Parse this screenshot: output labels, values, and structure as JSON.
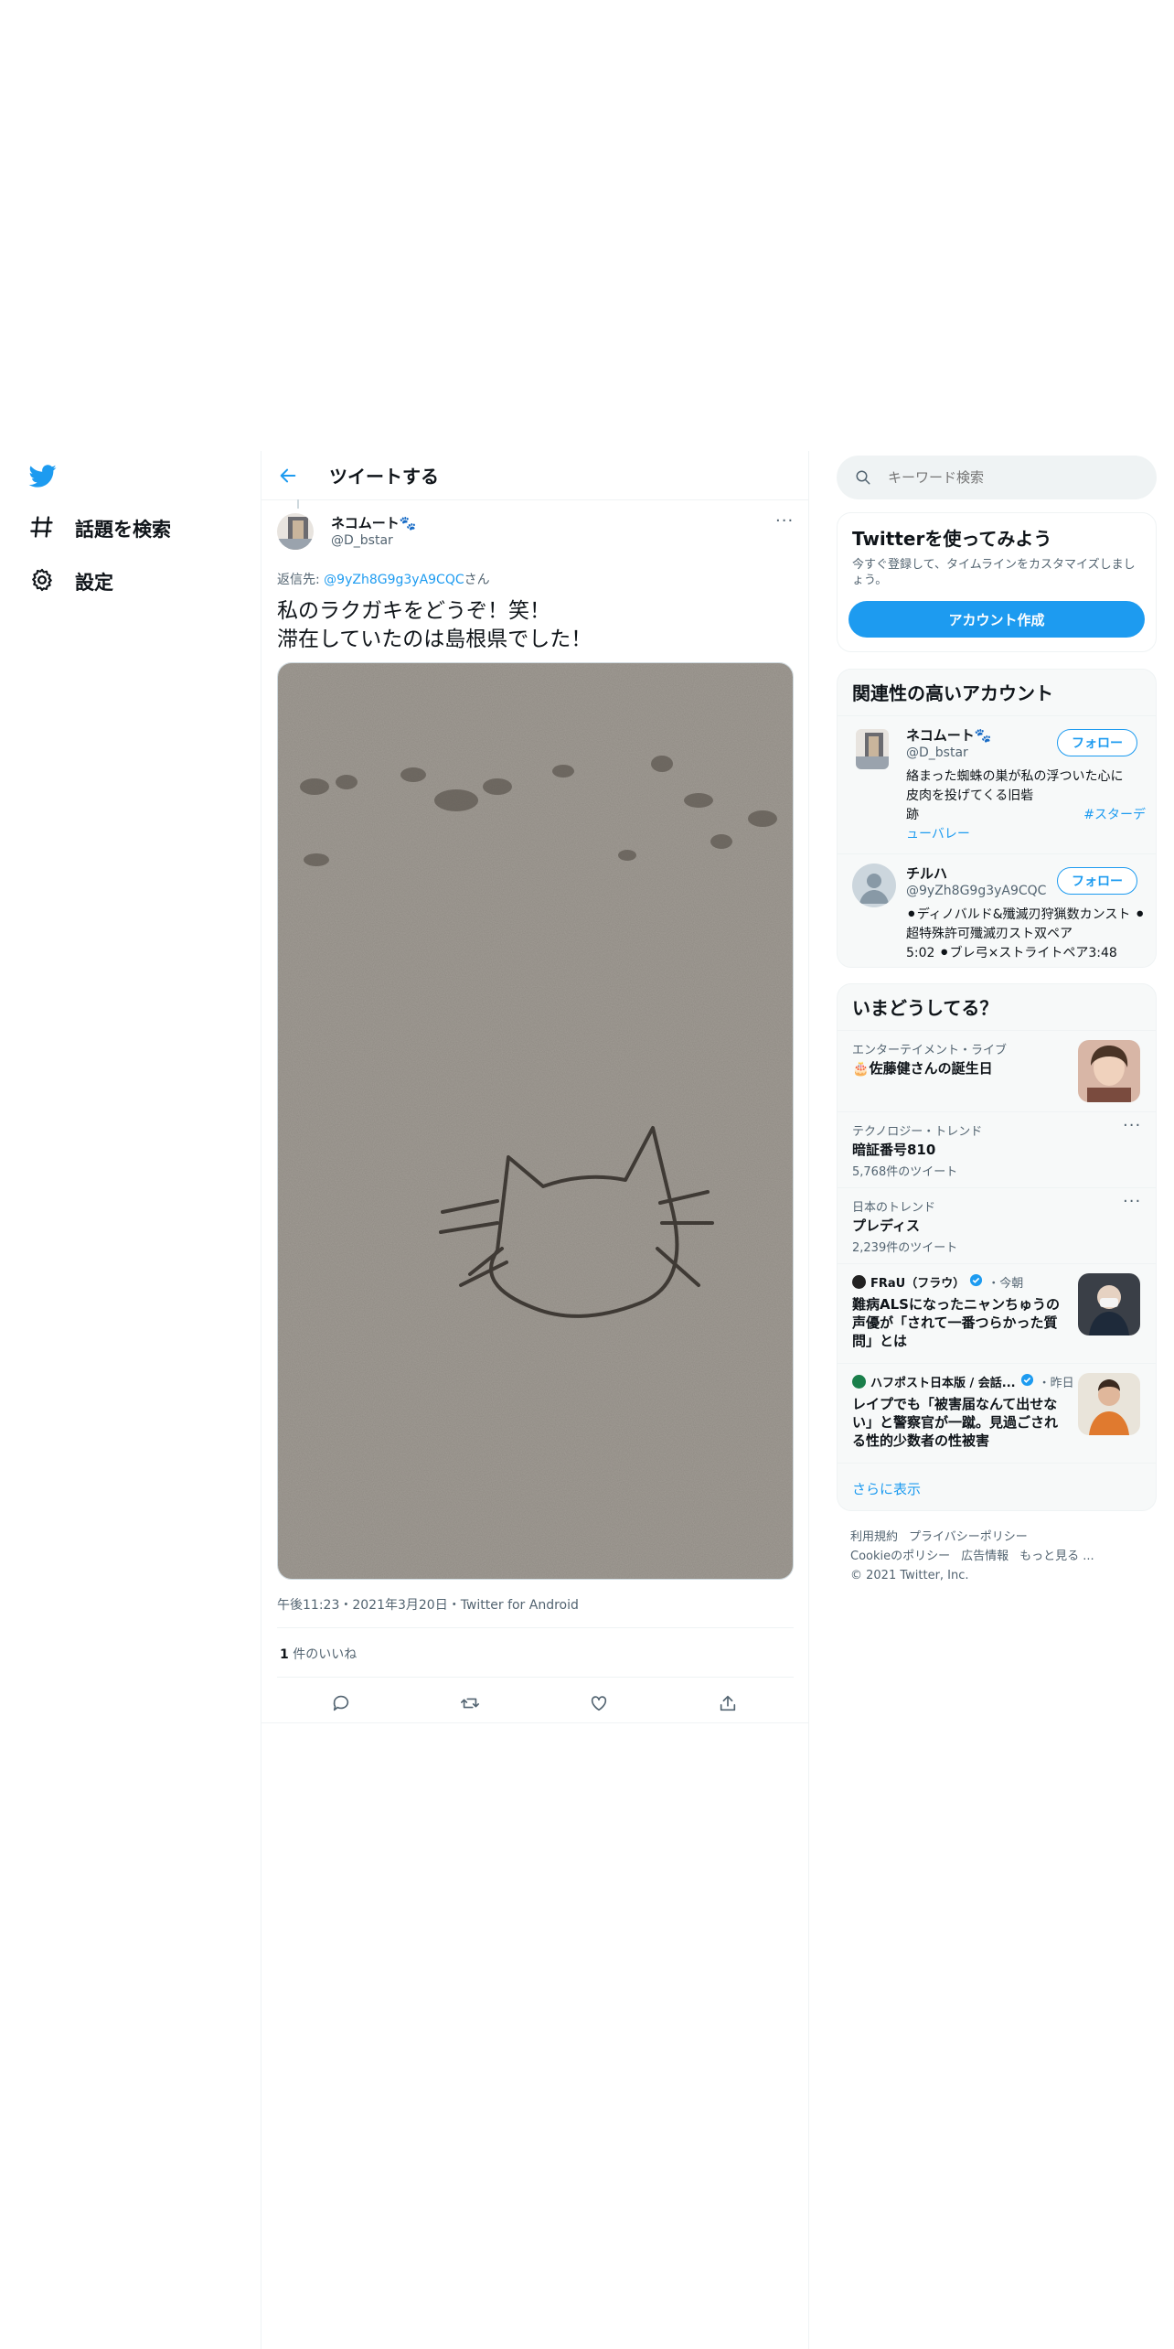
{
  "left_nav": {
    "logo_icon": "twitter-bird-icon",
    "items": [
      {
        "label": "話題を検索",
        "icon": "hashtag-icon"
      },
      {
        "label": "設定",
        "icon": "gear-icon"
      }
    ]
  },
  "header": {
    "title": "ツイートする",
    "back_icon": "back-arrow-icon"
  },
  "tweet": {
    "display_name": "ネコムート🐾",
    "handle": "@D_bstar",
    "reply_prefix": "返信先: ",
    "reply_to": "@9yZh8G9g3yA9CQC",
    "reply_suffix": "さん",
    "text": "私のラクガキをどうぞ！笑！\n滞在していたのは島根県でした！",
    "more_label": "···",
    "photo_alt": "砂浜に描かれた猫の顔のラクガキ",
    "timestamp": "午後11:23・2021年3月20日・Twitter for Android",
    "likes_count": "1",
    "likes_label": " 件のいいね",
    "actions": [
      "reply-icon",
      "retweet-icon",
      "like-icon",
      "share-icon"
    ]
  },
  "search": {
    "placeholder": "キーワード検索"
  },
  "signup_card": {
    "title": "Twitterを使ってみよう",
    "desc": "今すぐ登録して、タイムラインをカスタマイズしましょう。",
    "button": "アカウント作成"
  },
  "relevant": {
    "title": "関連性の高いアカウント",
    "follow_label": "フォロー",
    "accounts": [
      {
        "name": "ネコムート🐾",
        "handle": "@D_bstar",
        "bio_1": "絡まった蜘蛛の巣が私の浮ついた心に",
        "bio_2": "皮肉を投げてくる旧砦",
        "bio_3a": "跡",
        "bio_3b": "#スターデ",
        "bio_4": "ューバレー"
      },
      {
        "name": "チルハ",
        "handle": "@9yZh8G9g3yA9CQC",
        "bio_1": "⚫ディノバルド&殲滅刃狩猟数カンスト ⚫超特殊許可殲滅刃スト双ペア",
        "bio_2": "5:02 ⚫ブレ弓×ストライトペア3:48"
      }
    ]
  },
  "trends": {
    "title": "いまどうしてる？",
    "items": [
      {
        "context": "エンターテイメント・ライブ",
        "name": "🎂佐藤健さんの誕生日"
      },
      {
        "context": "テクノロジー・トレンド",
        "name": "暗証番号810",
        "count": "5,768件のツイート"
      },
      {
        "context": "日本のトレンド",
        "name": "プレディス",
        "count": "2,239件のツイート"
      }
    ],
    "news": [
      {
        "source": "FRaU（フラウ）",
        "time": "・今朝",
        "headline": "難病ALSになったニャンちゅうの声優が「されて一番つらかった質問」とは"
      },
      {
        "source": "ハフポスト日本版 / 会話...",
        "time": "・昨日",
        "headline": "レイプでも「被害届なんて出せない」と警察官が一蹴。見過ごされる性的少数者の性被害"
      }
    ],
    "show_more": "さらに表示"
  },
  "footer": {
    "links_1": [
      "利用規約",
      "プライバシーポリシー"
    ],
    "links_2": [
      "Cookieのポリシー",
      "広告情報",
      "もっと見る ..."
    ],
    "copyright": "© 2021 Twitter, Inc."
  },
  "colors": {
    "accent": "#1d9bf0",
    "text": "#0f1419",
    "muted": "#536471",
    "border": "#eff3f4",
    "card_bg": "#f7f9f9"
  }
}
